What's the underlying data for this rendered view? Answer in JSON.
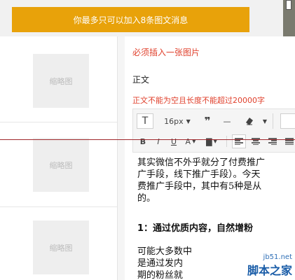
{
  "notice": {
    "text": "你最多只可以加入8条图文消息"
  },
  "left_list": {
    "items": [
      {
        "thumb_label": "缩略图"
      },
      {
        "thumb_label": "缩略图"
      },
      {
        "thumb_label": "缩略图"
      }
    ]
  },
  "editor": {
    "image_required_error": "必须插入一张图片",
    "body_label": "正文",
    "body_length_error": "正文不能为空且长度不能超过20000字",
    "toolbar": {
      "text_format_icon": "T",
      "font_size": "16px",
      "quote_icon": "❞",
      "hr_icon": "—",
      "bold": "B",
      "italic": "I",
      "underline": "U",
      "font_color": "A",
      "bg_color": "▇"
    },
    "content": {
      "lines_1": [
        "其实微信不外乎就分了付费推广",
        "广手段，线下推广手段）。今天",
        "费推广手段中，其中有5种是从",
        "的。"
      ],
      "heading": "1：通过优质内容，自然增粉",
      "lines_2": [
        "可能大多数中",
        "是通过发内",
        "期的粉丝就"
      ]
    }
  },
  "watermark": {
    "site": "jb51.net",
    "name": "脚本之家"
  },
  "colors": {
    "notice_bg": "#e8a20a",
    "error": "#e0412d",
    "divider": "#a0282c"
  }
}
